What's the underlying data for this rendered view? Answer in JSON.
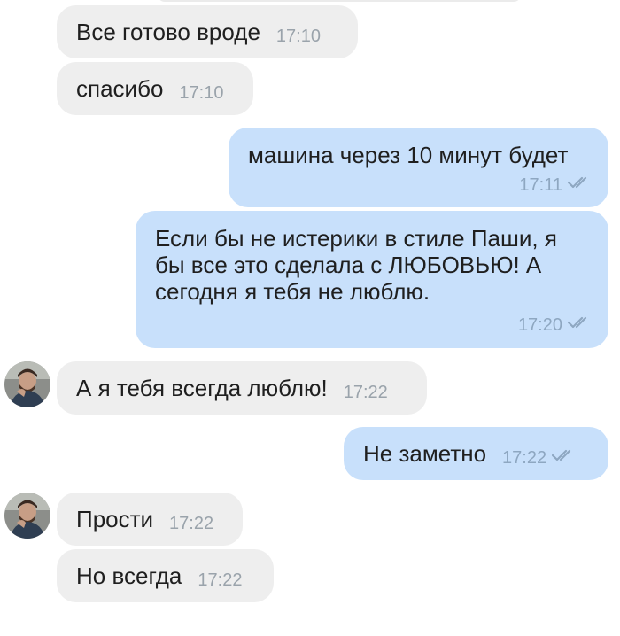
{
  "colors": {
    "incoming_bubble": "#eeeeee",
    "outgoing_bubble": "#c8e0fb",
    "incoming_time": "#9aa3ab",
    "outgoing_time": "#8ea7c1",
    "message_text": "#1f1f1f"
  },
  "icons": {
    "read_receipt": "double-check-icon",
    "avatar": "contact-avatar"
  },
  "messages": [
    {
      "text": "Все готово вроде",
      "time": "17:10"
    },
    {
      "text": "спасибо",
      "time": "17:10"
    },
    {
      "text": "машина через 10 минут будет",
      "time": "17:11"
    },
    {
      "text": "Если бы не истерики в стиле Паши, я\nбы все это сделала с ЛЮБОВЬЮ! А\nсегодня я тебя не люблю.",
      "time": "17:20"
    },
    {
      "text": "А я тебя всегда люблю!",
      "time": "17:22"
    },
    {
      "text": "Не заметно",
      "time": "17:22"
    },
    {
      "text": "Прости",
      "time": "17:22"
    },
    {
      "text": "Но всегда",
      "time": "17:22"
    }
  ]
}
